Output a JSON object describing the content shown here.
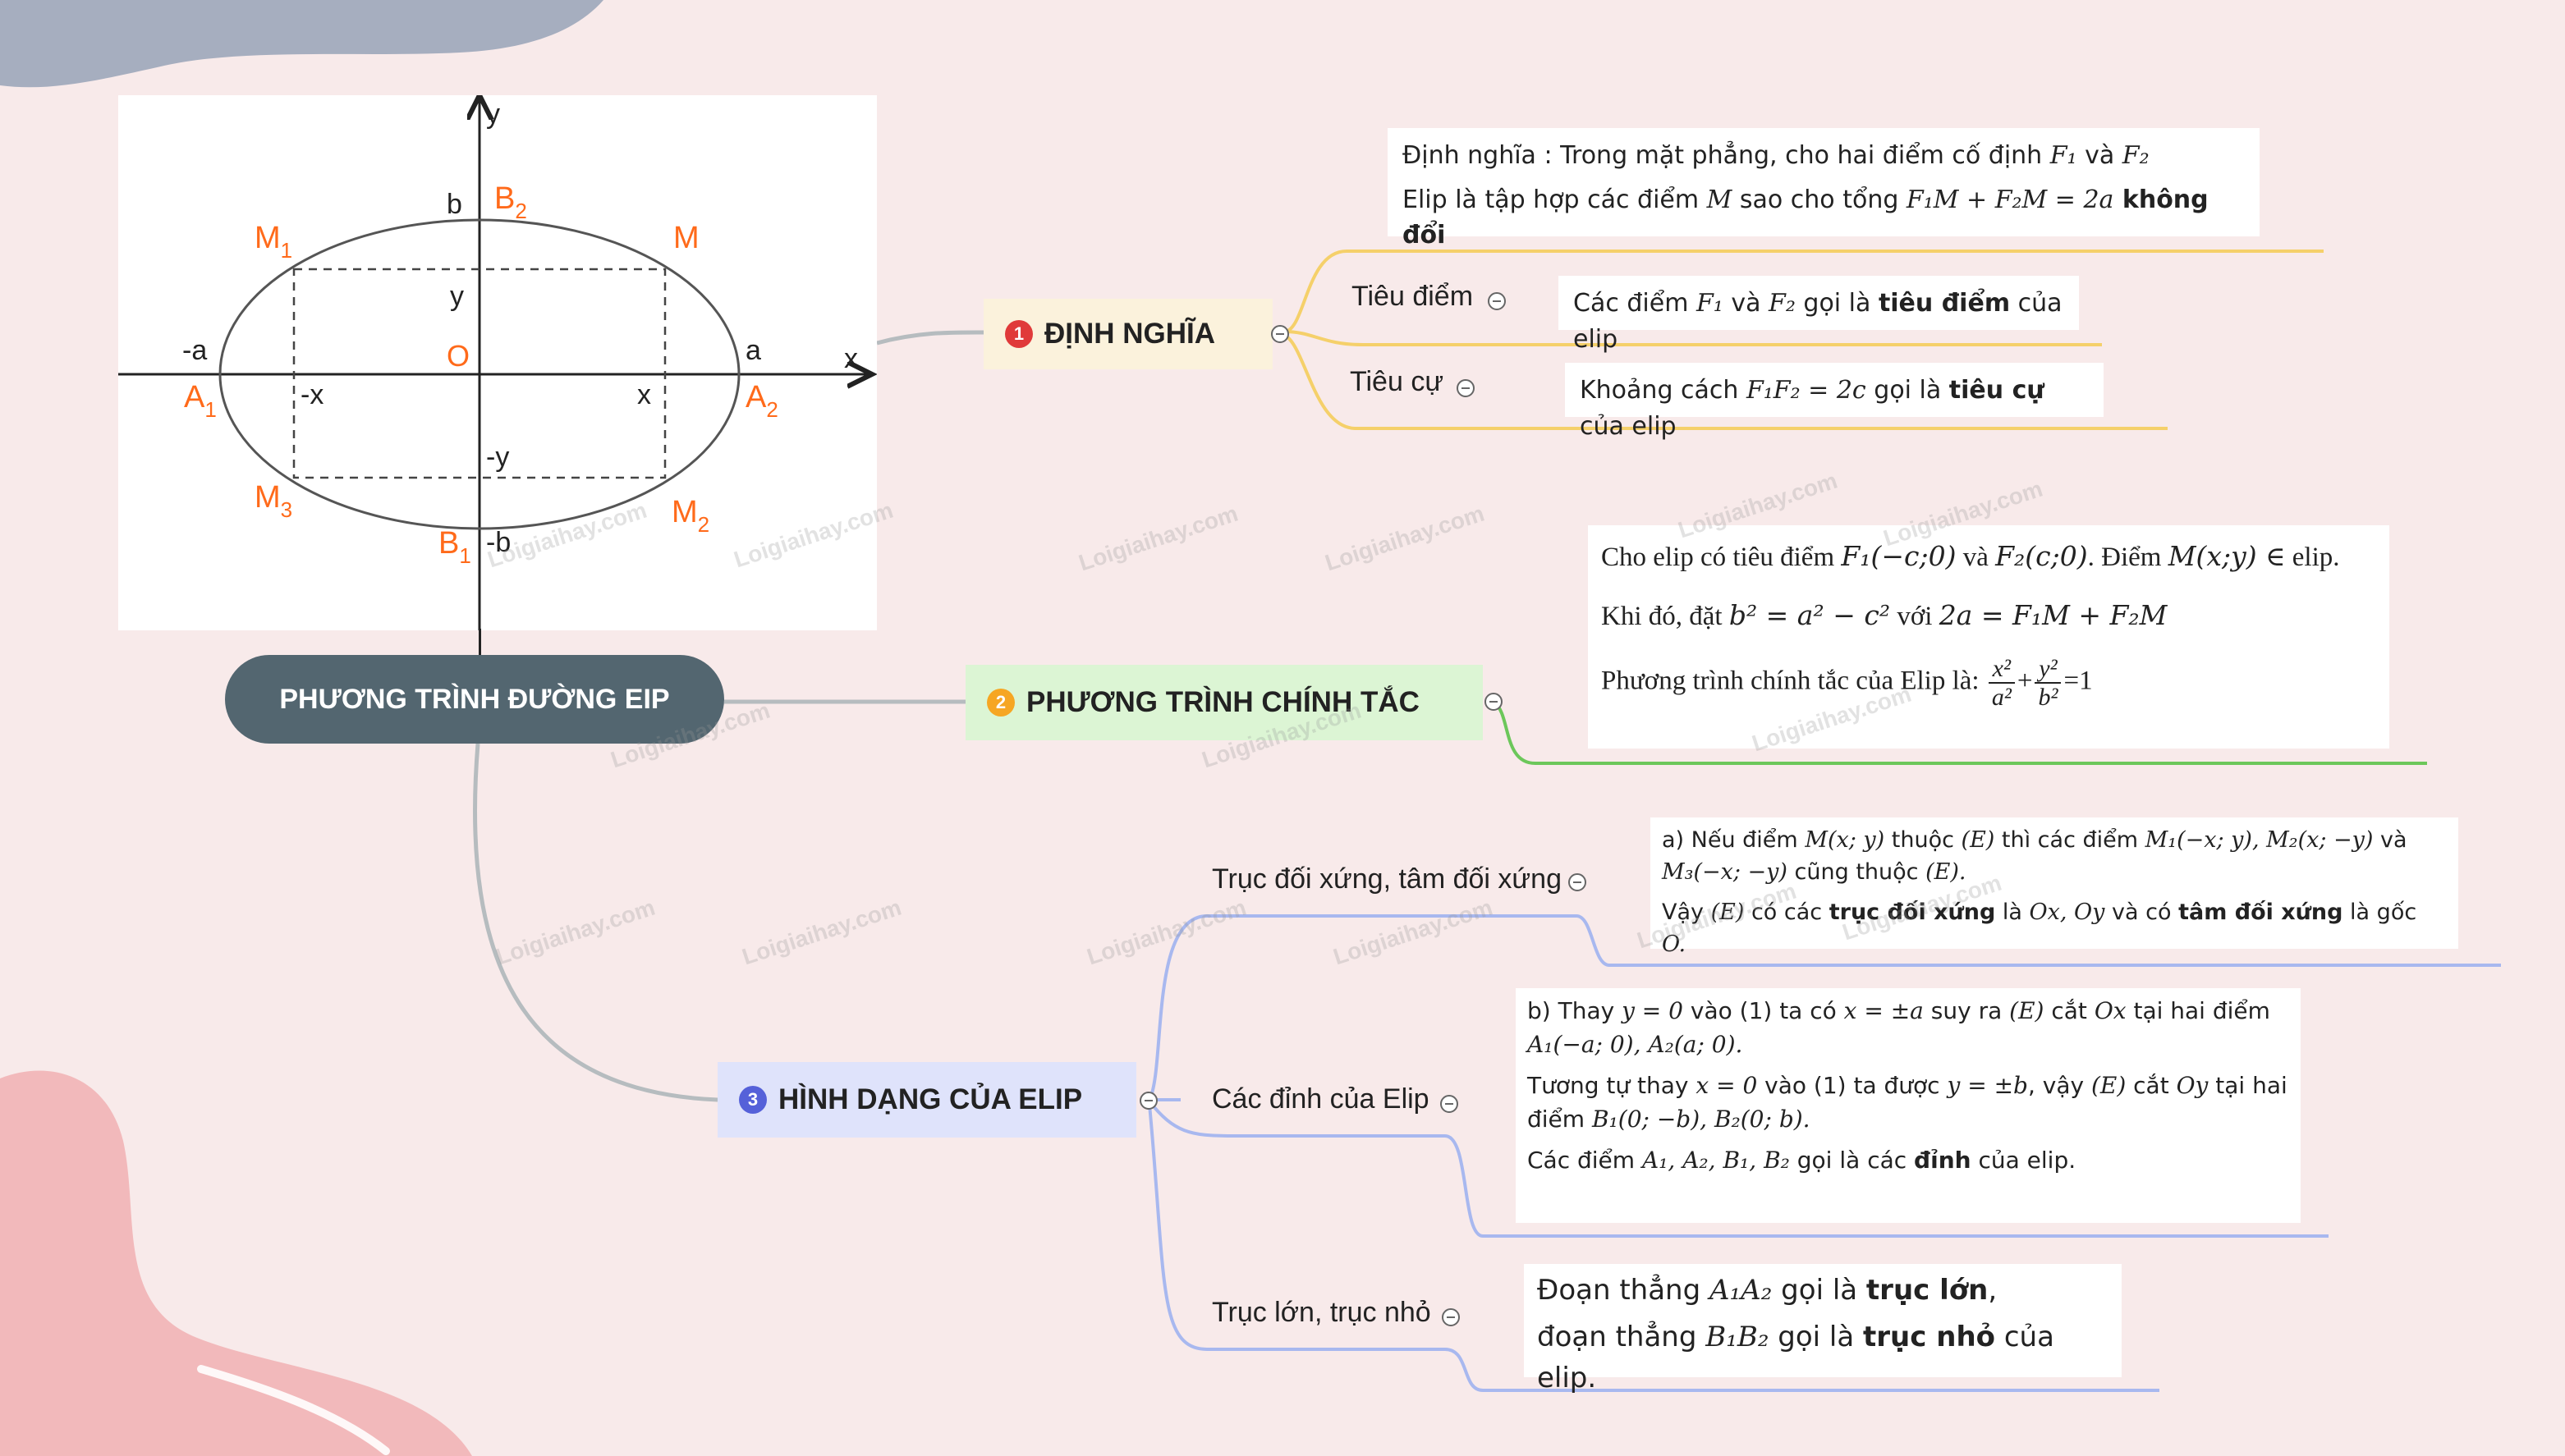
{
  "central_topic": "PHƯƠNG TRÌNH ĐƯỜNG EIP",
  "watermark": "Loigiaihay.com",
  "colors": {
    "background": "#f8eaea",
    "central": "#536670",
    "branch1_line": "#f5d06a",
    "branch2_line": "#6cc75a",
    "branch3_line": "#a8b8ef",
    "axis_point_labels": "#ff6a1a"
  },
  "graph": {
    "axis_x": "x",
    "axis_y": "y",
    "origin": "O",
    "neg_a": "-a",
    "pos_a": "a",
    "pos_b": "b",
    "neg_b": "-b",
    "neg_x": "-x",
    "pos_x": "x",
    "pos_y": "y",
    "neg_y": "-y",
    "A1": {
      "base": "A",
      "sub": "1"
    },
    "A2": {
      "base": "A",
      "sub": "2"
    },
    "B1": {
      "base": "B",
      "sub": "1"
    },
    "B2": {
      "base": "B",
      "sub": "2"
    },
    "M": "M",
    "M1": {
      "base": "M",
      "sub": "1"
    },
    "M2": {
      "base": "M",
      "sub": "2"
    },
    "M3": {
      "base": "M",
      "sub": "3"
    }
  },
  "branch1": {
    "number": "1",
    "badge_color": "#e03a3a",
    "title": "ĐỊNH NGHĨA",
    "definition": {
      "line1_pre": "Định nghĩa : Trong mặt phẳng, cho hai điểm cố định ",
      "F1": "F₁",
      "line1_and": " và ",
      "F2": "F₂",
      "line2_pre": "Elip là tập hợp các điểm ",
      "M": "M",
      "line2_mid": " sao cho tổng ",
      "formula": "F₁M + F₂M = 2a",
      "line2_bold": " không đổi"
    },
    "focus": {
      "label": "Tiêu điểm",
      "text_pre": "Các điểm ",
      "F1": "F₁",
      "text_and": " và ",
      "F2": "F₂",
      "text_mid": " gọi là ",
      "text_bold": "tiêu điểm",
      "text_post": " của elip"
    },
    "focal_distance": {
      "label": "Tiêu cự",
      "text_pre": "Khoảng cách ",
      "formula": "F₁F₂ = 2c",
      "text_mid": " gọi là ",
      "text_bold": "tiêu cự",
      "text_post": " của elip"
    }
  },
  "branch2": {
    "number": "2",
    "badge_color": "#f6a623",
    "title": "PHƯƠNG TRÌNH CHÍNH TẮC",
    "line1_pre": "Cho elip có tiêu điểm ",
    "F1c": "F₁(−c;0)",
    "line1_and": " và ",
    "F2c": "F₂(c;0)",
    "line1_mid": ". Điểm ",
    "Mxy": "M(x;y) ∈",
    "line1_post": " elip.",
    "line2_pre": "Khi đó, đặt ",
    "b2": "b² = a² − c²",
    "line2_mid": " với ",
    "two_a": "2a = F₁M + F₂M",
    "line3_pre": "Phương trình chính tắc của Elip là: ",
    "frac1_num": "x²",
    "frac1_den": "a²",
    "plus": "+",
    "frac2_num": "y²",
    "frac2_den": "b²",
    "eq_one": "=1"
  },
  "branch3": {
    "number": "3",
    "badge_color": "#5561d9",
    "title": "HÌNH DẠNG CỦA ELIP",
    "symmetry": {
      "label": "Trục đối xứng, tâm đối xứng",
      "p1_a": "a) Nếu điểm ",
      "p1_M": "M(x; y)",
      "p1_b": " thuộc ",
      "p1_E": "(E)",
      "p1_c": " thì các điểm ",
      "p1_M1": "M₁(−x; y), M₂(x; −y)",
      "p1_d": " và ",
      "p1_M3": "M₃(−x; −y)",
      "p1_e": " cũng thuộc ",
      "p1_E2": "(E).",
      "p2_a": "Vậy ",
      "p2_E": "(E)",
      "p2_b": " có các ",
      "p2_bold1": "trục đối xứng",
      "p2_c": " là ",
      "p2_OxOy": "Ox, Oy",
      "p2_d": " và có ",
      "p2_bold2": "tâm đối xứng",
      "p2_e": " là gốc ",
      "p2_O": "O."
    },
    "vertices": {
      "label": "Các đỉnh của Elip",
      "p1_a": "b) Thay ",
      "p1_y0": "y = 0",
      "p1_b": " vào (1) ta có ",
      "p1_xa": "x = ±a",
      "p1_c": " suy ra ",
      "p1_E": "(E)",
      "p1_d": " cắt ",
      "p1_Ox": "Ox",
      "p1_e": " tại hai điểm ",
      "p1_pts": "A₁(−a; 0), A₂(a; 0).",
      "p2_a": "Tương tự thay ",
      "p2_x0": "x = 0",
      "p2_b": " vào (1) ta được ",
      "p2_yb": "y = ±b",
      "p2_c": ", vậy ",
      "p2_E": "(E)",
      "p2_d": " cắt ",
      "p2_Oy": "Oy",
      "p2_e": " tại hai điểm ",
      "p2_pts": "B₁(0; −b), B₂(0; b).",
      "p3_a": "Các điểm ",
      "p3_pts": "A₁, A₂, B₁, B₂",
      "p3_b": " gọi là các ",
      "p3_bold": "đỉnh",
      "p3_c": " của elip."
    },
    "axes": {
      "label": "Trục lớn, trục nhỏ",
      "l1_a": "Đoạn thẳng ",
      "l1_seg": "A₁A₂",
      "l1_b": " gọi là ",
      "l1_bold": "trục lớn",
      "l1_c": ",",
      "l2_a": "đoạn thẳng ",
      "l2_seg": "B₁B₂",
      "l2_b": " gọi là ",
      "l2_bold": "trục nhỏ",
      "l2_c": " của elip."
    }
  }
}
